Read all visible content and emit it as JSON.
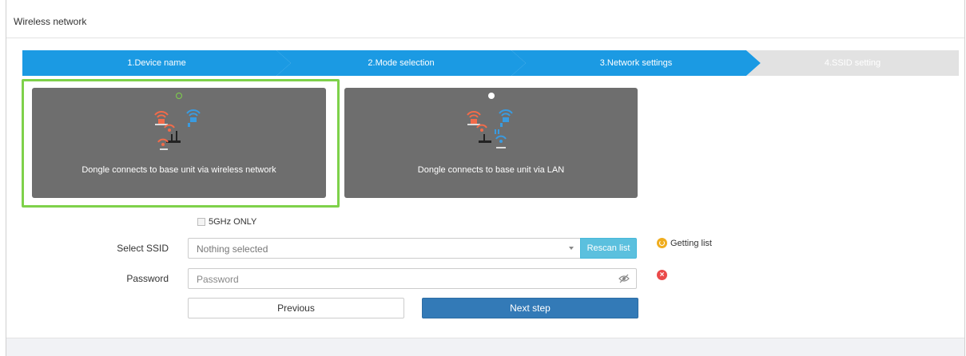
{
  "header": {
    "title": "Wireless network"
  },
  "steps": [
    {
      "label": "1.Device name",
      "state": "complete"
    },
    {
      "label": "2.Mode selection",
      "state": "complete"
    },
    {
      "label": "3.Network settings",
      "state": "active"
    },
    {
      "label": "4.SSID setting",
      "state": "pending"
    }
  ],
  "colors": {
    "step_active": "#1b9ae3",
    "step_pending": "#e2e2e2",
    "card_bg": "#6e6e6e",
    "selected_outline": "#7ed14a",
    "primary": "#337ab7",
    "info": "#5bc0de",
    "warning": "#f0ad1e",
    "danger": "#ea4a4a"
  },
  "modes": [
    {
      "label": "Dongle connects to base unit via wireless network",
      "selected": true,
      "icon": "wireless-network-topology-icon"
    },
    {
      "label": "Dongle connects to base unit via LAN",
      "selected": false,
      "icon": "lan-network-topology-icon"
    }
  ],
  "form": {
    "five_ghz_label": "5GHz ONLY",
    "ssid_label": "Select SSID",
    "ssid_value": "Nothing selected",
    "rescan_label": "Rescan list",
    "status_text": "Getting list",
    "password_label": "Password",
    "password_placeholder": "Password",
    "previous_label": "Previous",
    "next_label": "Next step"
  }
}
